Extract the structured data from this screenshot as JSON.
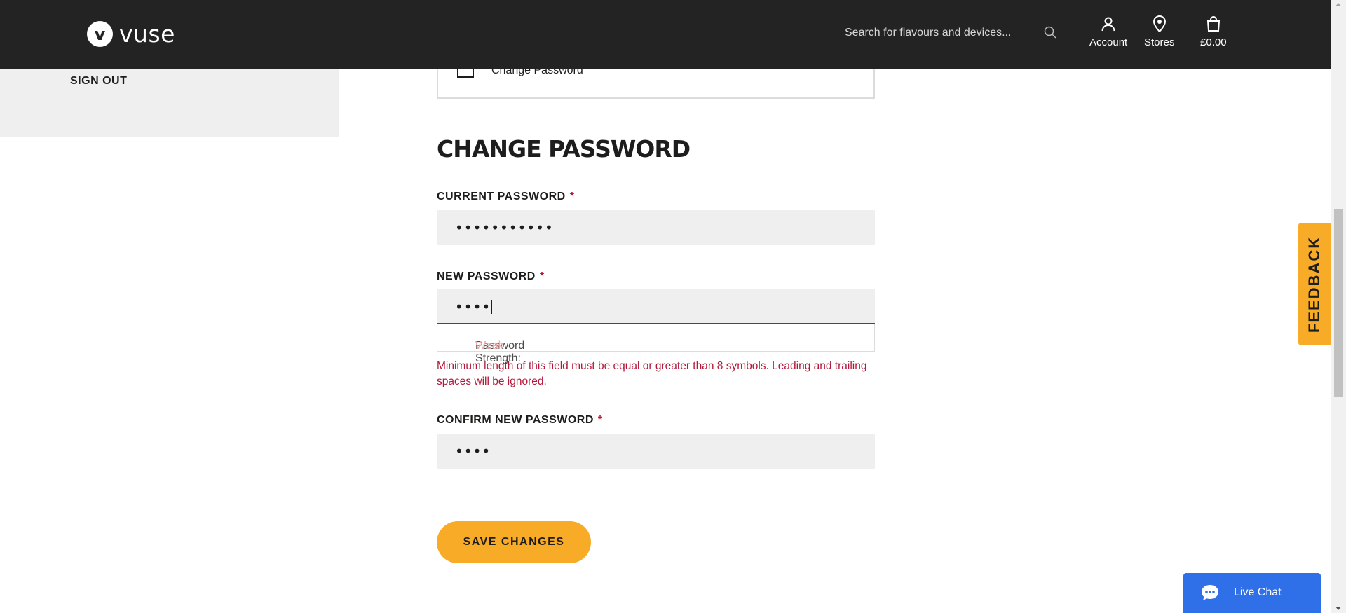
{
  "header": {
    "logo_mark": "v",
    "logo_text": "vuse",
    "search_placeholder": "Search for flavours and devices...",
    "account_label": "Account",
    "stores_label": "Stores",
    "cart_total": "£0.00"
  },
  "sidebar": {
    "signout_label": "SIGN OUT"
  },
  "tab": {
    "label": "Change Password"
  },
  "form": {
    "title": "CHANGE PASSWORD",
    "current_password": {
      "label": "CURRENT PASSWORD",
      "required_mark": "*",
      "value": "•••••••••••"
    },
    "new_password": {
      "label": "NEW PASSWORD",
      "required_mark": "*",
      "value": "••••"
    },
    "strength": {
      "label": "Password Strength:",
      "value": "Weak"
    },
    "error": "Minimum length of this field must be equal or greater than 8 symbols. Leading and trailing spaces will be ignored.",
    "confirm_password": {
      "label": "CONFIRM NEW PASSWORD",
      "required_mark": "*",
      "value": "••••"
    },
    "save_label": "SAVE CHANGES"
  },
  "feedback_label": "FEEDBACK",
  "livechat_label": "Live Chat",
  "colors": {
    "header_bg": "#232323",
    "accent": "#f8ab26",
    "error": "#b3183a",
    "chat": "#2f6fe8"
  }
}
